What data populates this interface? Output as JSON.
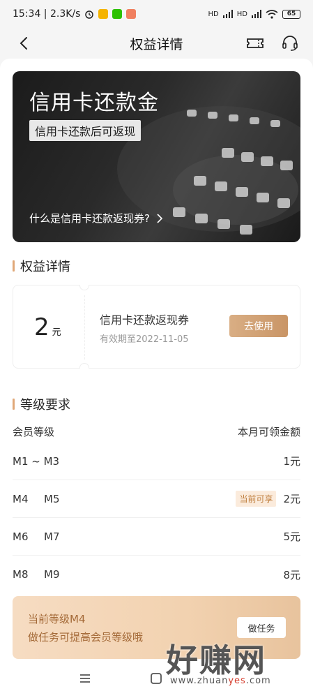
{
  "status_bar": {
    "time_speed": "15:34 | 2.3K/s",
    "signal_1": "HD",
    "signal_2": "HD",
    "battery": "65"
  },
  "nav": {
    "title": "权益详情"
  },
  "hero": {
    "title": "信用卡还款金",
    "tag": "信用卡还款后可返现",
    "link": "什么是信用卡还款返现券?"
  },
  "benefit_section": {
    "title": "权益详情"
  },
  "coupon": {
    "amount": "2",
    "unit": "元",
    "name": "信用卡还款返现券",
    "expiry": "有效期至2022-11-05",
    "action": "去使用"
  },
  "level_section": {
    "title": "等级要求",
    "col_level": "会员等级",
    "col_amount": "本月可领金额",
    "rows": [
      {
        "a": "M1 ~ M3",
        "b": "",
        "badge": "",
        "amount": "1元"
      },
      {
        "a": "M4",
        "b": "M5",
        "badge": "当前可享",
        "amount": "2元"
      },
      {
        "a": "M6",
        "b": "M7",
        "badge": "",
        "amount": "5元"
      },
      {
        "a": "M8",
        "b": "M9",
        "badge": "",
        "amount": "8元"
      }
    ]
  },
  "banner": {
    "line1": "当前等级M4",
    "line2": "做任务可提高会员等级哦",
    "action": "做任务"
  },
  "watermark": {
    "main": "好赚网",
    "url_prefix": "www.zhuan",
    "url_highlight": "yes",
    "url_suffix": ".com"
  },
  "colors": {
    "accent": "#e0a878",
    "button_gold": "#c99566",
    "badge_bg": "#fbebdc",
    "badge_text": "#c08040",
    "banner_text": "#a46a38"
  }
}
